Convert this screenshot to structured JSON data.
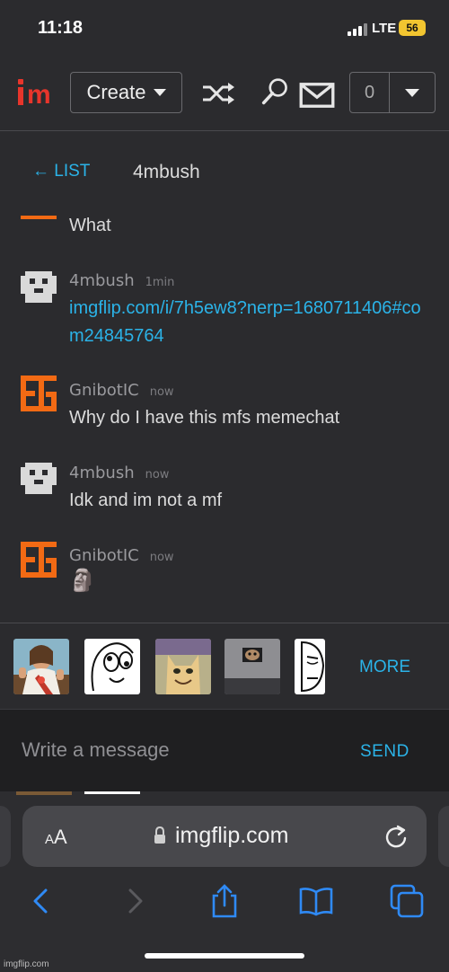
{
  "status_bar": {
    "time": "11:18",
    "network": "LTE",
    "battery": "56"
  },
  "header": {
    "logo_alt": "im",
    "create_label": "Create",
    "notification_count": "0",
    "icons": [
      "shuffle-icon",
      "search-icon",
      "mail-icon",
      "chevron-down-icon"
    ]
  },
  "chat": {
    "back_label": "← LIST",
    "title": "4mbush"
  },
  "messages": [
    {
      "user": "",
      "time": "",
      "text": "What"
    },
    {
      "user": "4mbush",
      "time": "1min",
      "link": "imgflip.com/i/7h5ew8?nerp=1680711406#com24845764"
    },
    {
      "user": "GnibotIC",
      "time": "now",
      "text": "Why do I have this mfs memechat"
    },
    {
      "user": "4mbush",
      "time": "now",
      "text": "Idk and im not a mf"
    },
    {
      "user": "GnibotIC",
      "time": "now",
      "text": "🗿"
    }
  ],
  "meme_strip": {
    "thumbnails": [
      "buddy-christ",
      "derp-face",
      "smiling-cat",
      "ceiling-cat",
      "okay-guy"
    ],
    "more_label": "MORE"
  },
  "composer": {
    "placeholder": "Write a message",
    "send_label": "SEND"
  },
  "browser": {
    "text_size_label_small": "A",
    "text_size_label_large": "A",
    "domain": "imgflip.com",
    "watermark": "imgflip.com"
  },
  "colors": {
    "accent": "#2bb3e8",
    "brand": "#e8352b",
    "avatar_orange": "#f26a14",
    "background": "#2b2b2e"
  }
}
